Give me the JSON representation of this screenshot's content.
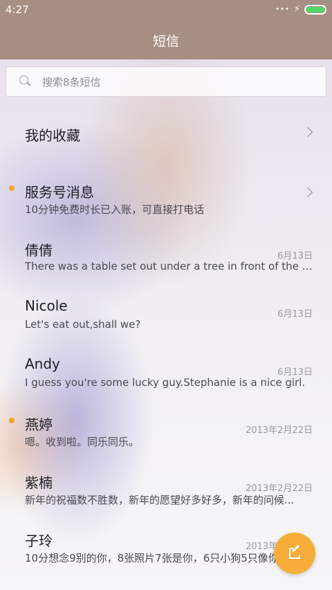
{
  "status_bar": {
    "time": "4:27",
    "battery_level": 1.0,
    "battery_color": "#4cd964"
  },
  "header": {
    "title": "短信",
    "background_color": "#a88f83"
  },
  "search": {
    "placeholder": "搜索8条短信",
    "icon": "search-icon"
  },
  "conversations": [
    {
      "title": "我的收藏",
      "preview": "",
      "date": "",
      "unread": false,
      "chevron": true
    },
    {
      "title": "服务号消息",
      "preview": "10分钟免费时长已入账，可直接打电话",
      "date": "",
      "unread": true,
      "chevron": true
    },
    {
      "title": "倩倩",
      "preview": "There was a table set out under a tree in front of the ho...",
      "date": "6月13日",
      "unread": false,
      "chevron": false
    },
    {
      "title": "Nicole",
      "preview": "Let's eat out,shall we?",
      "date": "6月13日",
      "unread": false,
      "chevron": false
    },
    {
      "title": "Andy",
      "preview": "I guess you're some lucky guy.Stephanie is a nice girl.",
      "date": "6月13日",
      "unread": false,
      "chevron": false
    },
    {
      "title": "燕婷",
      "preview": "嗯。收到啦。同乐同乐。",
      "date": "2013年2月22日",
      "unread": true,
      "chevron": false
    },
    {
      "title": "紫楠",
      "preview": "新年的祝福数不胜数，新年的愿望好多好多，新年的问候...",
      "date": "2013年2月22日",
      "unread": false,
      "chevron": false
    },
    {
      "title": "子玲",
      "preview": "10分想念9别的你，8张照片7张是你，6只小狗5只像你",
      "date": "2013年2月22日",
      "unread": false,
      "chevron": false
    }
  ],
  "fab": {
    "icon": "compose-icon",
    "color": "#f7ad3a"
  },
  "accent_color": "#f5a623"
}
